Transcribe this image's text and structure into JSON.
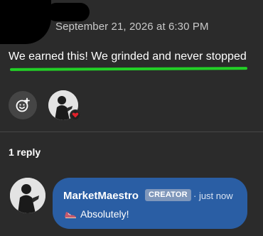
{
  "comment": {
    "timestamp": "September 21, 2026 at 6:30 PM",
    "text": "We earned this! We grinded and never stopped",
    "highlight_color": "#22d026"
  },
  "actions": {
    "add_reaction_icon": "add-reaction-icon",
    "liker_avatar_icon": "avatar"
  },
  "replies": {
    "count_label": "1 reply",
    "items": [
      {
        "author": "MarketMaestro",
        "badge": "CREATOR",
        "time": "· just now",
        "emoji_icon": "shoe-icon",
        "text": "Absolutely!",
        "bubble_color": "#2a5ea4"
      }
    ]
  }
}
